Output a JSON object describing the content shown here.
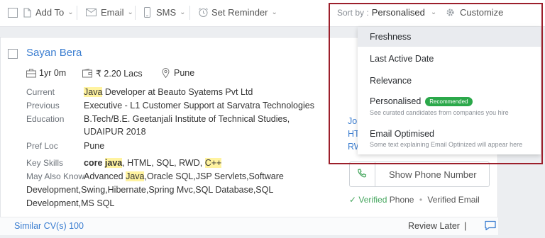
{
  "toolbar": {
    "add_to": "Add To",
    "email": "Email",
    "sms": "SMS",
    "set_reminder": "Set Reminder",
    "sort_by_label": "Sort by :",
    "sort_by_value": "Personalised",
    "customize": "Customize"
  },
  "sort_menu": {
    "items": [
      {
        "label": "Freshness",
        "sub": "",
        "badge": ""
      },
      {
        "label": "Last Active Date",
        "sub": "",
        "badge": ""
      },
      {
        "label": "Relevance",
        "sub": "",
        "badge": ""
      },
      {
        "label": "Personalised",
        "sub": "See curated candidates from companies you hire",
        "badge": "Recommended"
      },
      {
        "label": "Email Optimised",
        "sub": "Some text explaining Email Optinized will appear here",
        "badge": ""
      }
    ],
    "active_index": 0
  },
  "candidate": {
    "name": "Sayan Bera",
    "experience": "1yr 0m",
    "salary": "₹ 2.20 Lacs",
    "location": "Pune",
    "current_label": "Current",
    "current_hl": "Java",
    "current_rest": " Developer at Beauto Syatems Pvt Ltd",
    "previous_label": "Previous",
    "previous_value": "Executive - L1 Customer Support at Sarvatra Technologies",
    "education_label": "Education",
    "education_line1": "B.Tech/B.E. Geetanjali Institute of Technical Studies,",
    "education_line2": "UDAIPUR 2018",
    "pref_loc_label": "Pref Loc",
    "pref_loc_value": "Pune",
    "key_skills_label": "Key Skills",
    "key_skills_core": "core ",
    "key_skills_java": "java",
    "key_skills_mid": ", HTML, SQL, RWD, ",
    "key_skills_cpp": "C++",
    "may_know_label": "May Also Know",
    "may_know_pre": "Advanced ",
    "may_know_java": "Java",
    "may_know_rest": ",Oracle SQL,JSP Servlets,Software",
    "may_know_line2": "Development,Swing,Hibernate,Spring Mvc,Spring Data,SQL Database,SQL",
    "may_know_line2_exact": "Development,Swing,Hibernate,Spring Mvc,SQL Database,SQL",
    "may_know_line3": "Development,MS SQL"
  },
  "right_panel": {
    "peek_1": "Jo",
    "peek_2": "HT",
    "peek_3": "RW",
    "show_phone": "Show Phone Number",
    "verified_phone": "Verified",
    "phone_word": "Phone",
    "dot": "•",
    "verified_email": "Verified Email"
  },
  "footer": {
    "similar": "Similar CV(s) 100",
    "review_later": "Review Later",
    "pipe": "|"
  },
  "colors": {
    "link": "#3a7dd0",
    "highlight": "#fff3a0",
    "badge": "#2ba84a",
    "outline": "#9c1f2b"
  }
}
